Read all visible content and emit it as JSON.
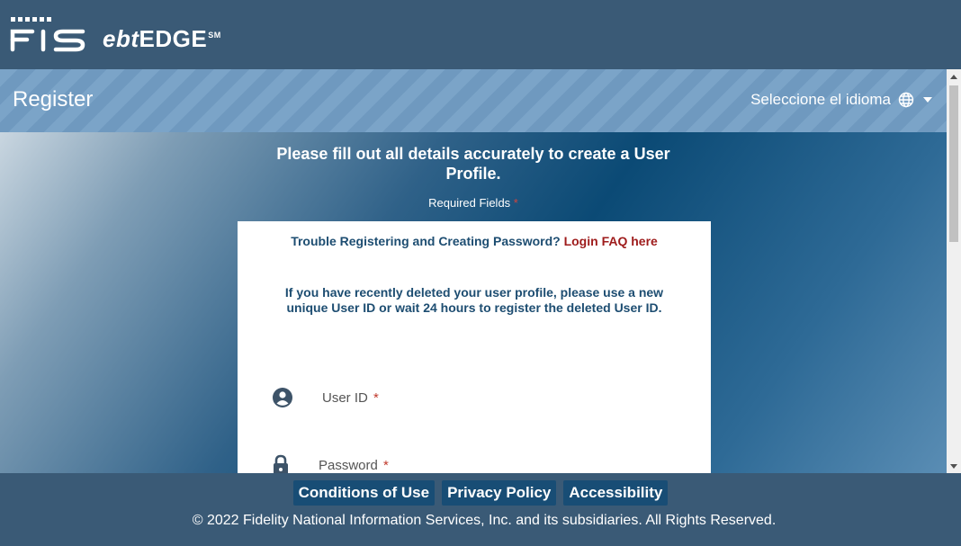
{
  "header": {
    "brand_word": "FIS",
    "product_prefix": "ebt",
    "product_name": "EDGE",
    "product_mark": "SM"
  },
  "register_bar": {
    "title": "Register",
    "language_label": "Seleccione el idioma",
    "language_icon": "globe-icon"
  },
  "intro": {
    "title": "Please fill out all details accurately to create a User Profile.",
    "required_text": "Required Fields",
    "required_mark": "*"
  },
  "card": {
    "trouble_text": "Trouble Registering and Creating Password? ",
    "trouble_link": "Login FAQ here",
    "notice": "If you have recently deleted your user profile, please use a new unique User ID or wait 24 hours to register the deleted User ID.",
    "fields": [
      {
        "label": "User ID",
        "required_mark": "*",
        "icon": "user-circle-icon"
      },
      {
        "label": "Password",
        "required_mark": "*",
        "icon": "lock-icon"
      }
    ]
  },
  "footer": {
    "links": [
      "Conditions of Use",
      "Privacy Policy",
      "Accessibility"
    ],
    "copyright": "© 2022 Fidelity National Information Services, Inc. and its subsidiaries. All Rights Reserved."
  },
  "colors": {
    "header_bg": "#3a5a76",
    "link_red": "#9e1b1b",
    "text_blue": "#1d4d71",
    "footer_button": "#184d75"
  }
}
